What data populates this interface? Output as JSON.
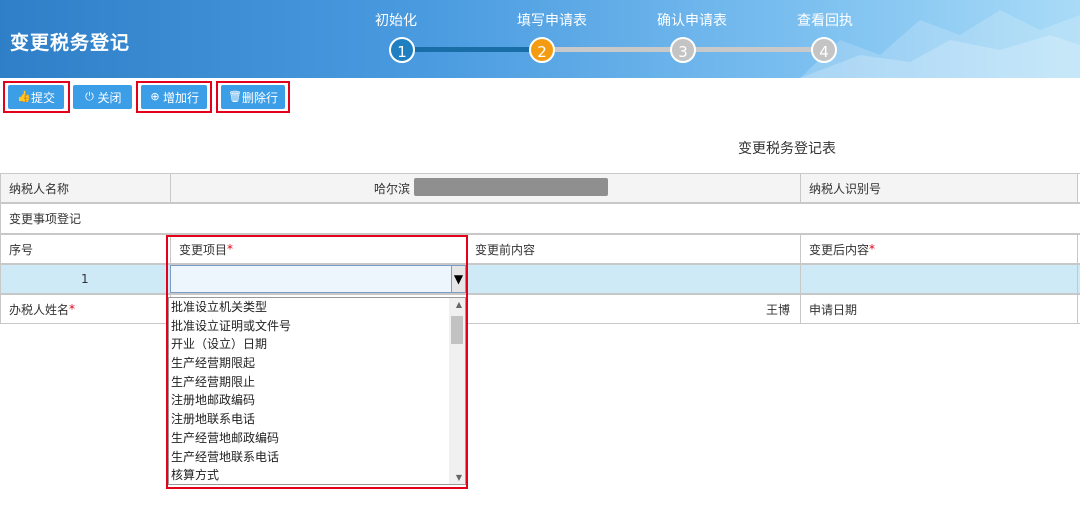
{
  "header": {
    "title": "变更税务登记",
    "steps": [
      {
        "label": "初始化",
        "num": "1"
      },
      {
        "label": "填写申请表",
        "num": "2"
      },
      {
        "label": "确认申请表",
        "num": "3"
      },
      {
        "label": "查看回执",
        "num": "4"
      }
    ]
  },
  "toolbar": {
    "submit": "提交",
    "close": "关闭",
    "add_row": "增加行",
    "delete_row": "删除行"
  },
  "form": {
    "title": "变更税务登记表",
    "taxpayer_name_label": "纳税人名称",
    "taxpayer_name_value": "哈尔滨",
    "taxpayer_id_label": "纳税人识别号",
    "section_label": "变更事项登记",
    "col_seq": "序号",
    "col_item": "变更项目",
    "col_before": "变更前内容",
    "col_after": "变更后内容",
    "required_mark": "*",
    "row_seq": "1",
    "handler_label": "办税人姓名",
    "handler_value": "王博",
    "apply_date_label": "申请日期"
  },
  "dropdown": {
    "options": [
      "批准设立机关类型",
      "批准设立证明或文件号",
      "开业（设立）日期",
      "生产经营期限起",
      "生产经营期限止",
      "注册地邮政编码",
      "注册地联系电话",
      "生产经营地邮政编码",
      "生产经营地联系电话",
      "核算方式"
    ]
  }
}
